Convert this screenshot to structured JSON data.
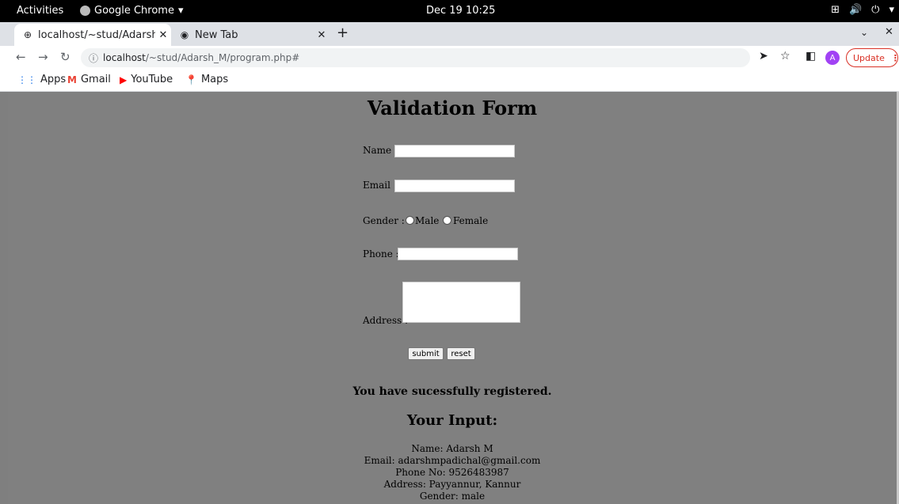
{
  "system_bar": {
    "activities": "Activities",
    "app_name": "Google Chrome",
    "clock": "Dec 19  10:25"
  },
  "tabs": [
    {
      "title": "localhost/~stud/Adarsh_M",
      "active": true
    },
    {
      "title": "New Tab",
      "active": false
    }
  ],
  "address_bar": {
    "host": "localhost",
    "path": "/~stud/Adarsh_M/program.php#"
  },
  "toolbar": {
    "avatar_letter": "A",
    "update_label": "Update"
  },
  "bookmarks": [
    {
      "label": "Apps",
      "icon": "apps-grid-icon"
    },
    {
      "label": "Gmail",
      "icon": "gmail-icon"
    },
    {
      "label": "YouTube",
      "icon": "youtube-icon"
    },
    {
      "label": "Maps",
      "icon": "maps-pin-icon"
    }
  ],
  "form": {
    "title": "Validation Form",
    "name_label": "Name :",
    "email_label": "Email :",
    "gender_label": "Gender :",
    "gender_options": [
      "Male",
      "Female"
    ],
    "phone_label": "Phone :",
    "address_label": "Address :",
    "submit_label": "submit",
    "reset_label": "reset"
  },
  "result": {
    "message": "You have sucessfully registered.",
    "heading": "Your Input:",
    "lines": [
      "Name: Adarsh M",
      "Email: adarshmpadichal@gmail.com",
      "Phone No: 9526483987",
      "Address: Payyannur, Kannur",
      "Gender: male"
    ]
  },
  "colors": {
    "page_background": "#808080",
    "update_accent": "#d93025",
    "avatar": "#a142f4"
  }
}
